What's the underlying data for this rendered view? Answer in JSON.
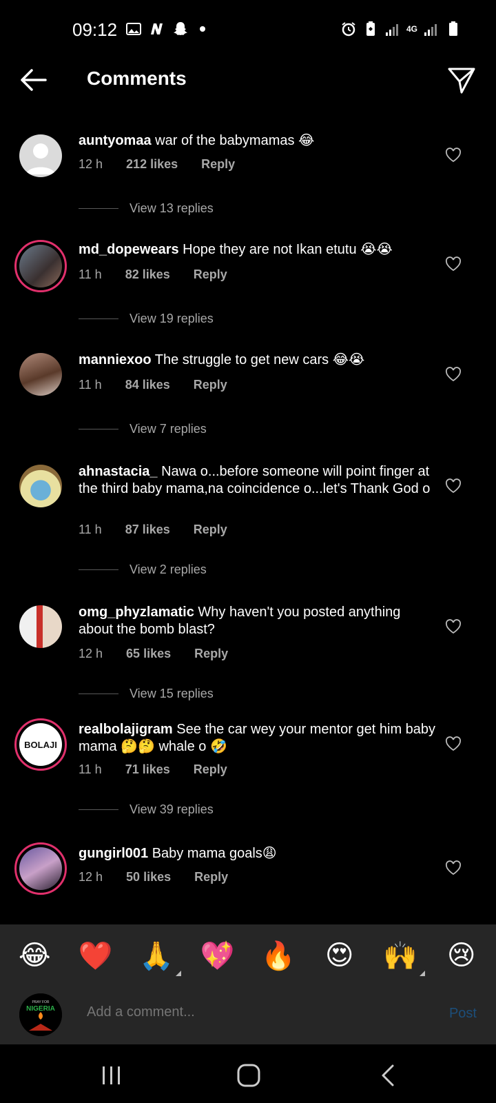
{
  "status_bar": {
    "time": "09:12",
    "network": "4G"
  },
  "header": {
    "title": "Comments"
  },
  "comments": [
    {
      "username": "auntyomaa",
      "text": "war of the babymamas 😂",
      "time": "12 h",
      "likes": "212 likes",
      "reply": "Reply",
      "view_replies": "View 13 replies",
      "avatar": "default-avatar"
    },
    {
      "username": "md_dopewears",
      "text": "Hope they are not Ikan etutu 😭😭",
      "time": "11 h",
      "likes": "82 likes",
      "reply": "Reply",
      "view_replies": "View 19 replies",
      "avatar": "photo-avatar"
    },
    {
      "username": "manniexoo",
      "text": "The struggle to get new cars 😂😭",
      "time": "11 h",
      "likes": "84 likes",
      "reply": "Reply",
      "view_replies": "View 7 replies",
      "avatar": "photo-avatar"
    },
    {
      "username": "ahnastacia_",
      "text": "Nawa o...before someone will point finger at the third baby mama,na coincidence o...let's Thank God o",
      "time": "11 h",
      "likes": "87 likes",
      "reply": "Reply",
      "view_replies": "View 2 replies",
      "avatar": "photo-avatar"
    },
    {
      "username": "omg_phyzlamatic",
      "text": "Why haven't you posted anything about the bomb blast?",
      "time": "12 h",
      "likes": "65 likes",
      "reply": "Reply",
      "view_replies": "View 15 replies",
      "avatar": "photo-avatar"
    },
    {
      "username": "realbolajigram",
      "text": "See the car wey your mentor get him baby mama 🤔🤔 whale o 🤣",
      "time": "11 h",
      "likes": "71 likes",
      "reply": "Reply",
      "view_replies": "View 39 replies",
      "avatar": "logo-avatar",
      "avatar_text": "BOLAJI"
    },
    {
      "username": "gungirl001",
      "text": "Baby mama goals😩",
      "time": "12 h",
      "likes": "50 likes",
      "reply": "Reply",
      "avatar": "photo-avatar"
    }
  ],
  "emoji_bar": [
    "😂",
    "❤️",
    "🙏",
    "💖",
    "🔥",
    "😍",
    "🙌",
    "😢"
  ],
  "composer": {
    "placeholder": "Add a comment...",
    "post_label": "Post",
    "avatar_text_top": "PRAY FOR",
    "avatar_text_main": "NIGERIA"
  },
  "colors": {
    "background": "#000000",
    "secondary_text": "#a8a8a8",
    "story_ring": "#e1306c",
    "post_disabled": "#1c4e7a",
    "input_bar": "#262626"
  }
}
